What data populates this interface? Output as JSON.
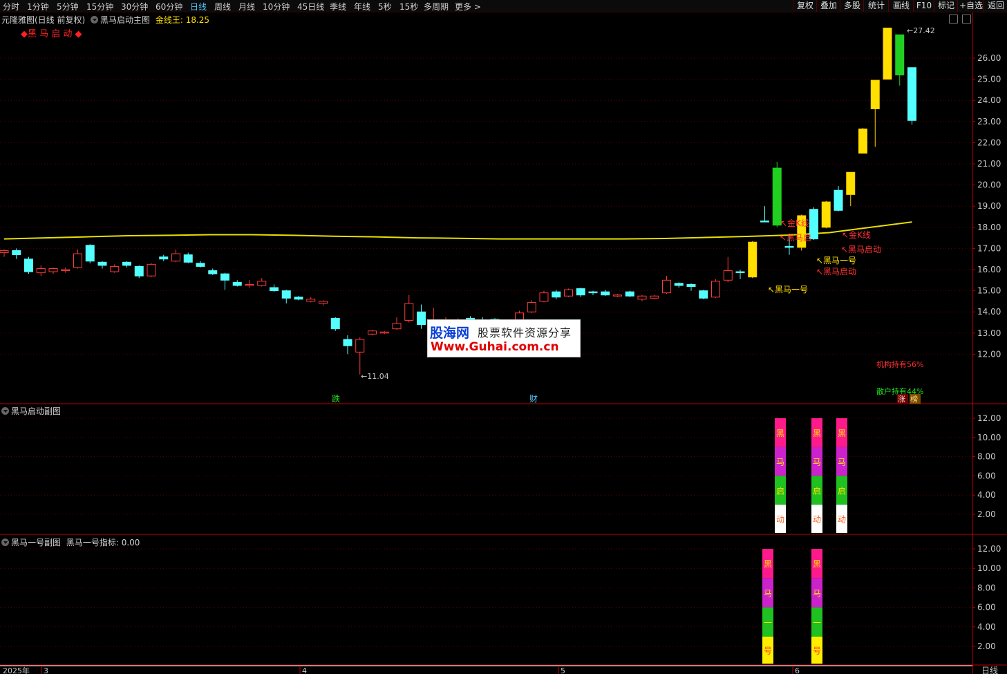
{
  "toolbar": {
    "periods": [
      "分时",
      "1分钟",
      "5分钟",
      "15分钟",
      "30分钟",
      "60分钟",
      "日线",
      "周线",
      "月线",
      "10分钟",
      "45日线",
      "季线",
      "年线",
      "5秒",
      "15秒",
      "多周期",
      "更多 >"
    ],
    "active_period": "日线",
    "right_buttons": [
      "复权",
      "叠加",
      "多股",
      "统计",
      "画线",
      "F10",
      "标记",
      "+自选",
      "返回"
    ]
  },
  "main_panel": {
    "font_name": "元隆雅图(日线 前复权)",
    "indicator_name": "黑马启动主图",
    "line_label": "金线王: 18.25",
    "signal_title": "◆黑 马 启 动 ◆",
    "high_label": "27.42",
    "low_label": "←11.04",
    "signals": {
      "jin_k": "金K线",
      "heima_qi": "黑马启",
      "heima_qidong": "黑马启动",
      "heima_yihao": "黑马一号"
    },
    "institution": "机构持有56%",
    "retail": "散户持有44%",
    "markers": {
      "die": "跌",
      "cai": "财",
      "zhang": "涨",
      "bang": "榜"
    },
    "y_ticks": [
      "26.00",
      "25.00",
      "24.00",
      "23.00",
      "22.00",
      "21.00",
      "20.00",
      "19.00",
      "18.00",
      "17.00",
      "16.00",
      "15.00",
      "14.00",
      "13.00",
      "12.00"
    ]
  },
  "sub_panel1": {
    "title": "黑马启动副图",
    "y_ticks": [
      "12.00",
      "10.00",
      "8.00",
      "6.00",
      "4.00",
      "2.00"
    ],
    "chars": [
      "黑",
      "马",
      "启",
      "动"
    ]
  },
  "sub_panel2": {
    "title": "黑马一号副图",
    "indicator_label": "黑马一号指标: 0.00",
    "y_ticks": [
      "12.00",
      "10.00",
      "8.00",
      "6.00",
      "4.00",
      "2.00"
    ],
    "chars": [
      "黑",
      "马",
      "一",
      "号"
    ]
  },
  "x_axis": {
    "labels": [
      "2025年",
      "3",
      "4",
      "5",
      "6"
    ],
    "corner": "日线"
  },
  "watermark": {
    "logo": "股海网",
    "subtitle": "股票软件资源分享",
    "url": "Www.Guhai.com.cn"
  },
  "colors": {
    "up": "#ff3b3b",
    "down": "#54ffff",
    "gold": "#ffe000",
    "green_bull": "#20d020",
    "line": "#e8e000",
    "grid": "#5a0000",
    "axis": "#c00000"
  },
  "chart_data": {
    "type": "candlestick",
    "title": "",
    "ylim": [
      10.7,
      27.8
    ],
    "candles": [
      {
        "o": 16.8,
        "h": 16.95,
        "l": 16.6,
        "c": 16.9,
        "s": "u"
      },
      {
        "o": 16.9,
        "h": 17.0,
        "l": 16.5,
        "c": 16.7,
        "s": "d"
      },
      {
        "o": 16.5,
        "h": 16.6,
        "l": 15.8,
        "c": 15.9,
        "s": "d"
      },
      {
        "o": 15.85,
        "h": 16.2,
        "l": 15.7,
        "c": 16.05,
        "s": "u"
      },
      {
        "o": 15.9,
        "h": 16.1,
        "l": 15.8,
        "c": 16.05,
        "s": "u"
      },
      {
        "o": 15.95,
        "h": 16.1,
        "l": 15.85,
        "c": 16.0,
        "s": "u"
      },
      {
        "o": 16.1,
        "h": 16.95,
        "l": 16.05,
        "c": 16.75,
        "s": "u"
      },
      {
        "o": 17.15,
        "h": 17.2,
        "l": 16.3,
        "c": 16.4,
        "s": "d"
      },
      {
        "o": 16.35,
        "h": 16.4,
        "l": 16.05,
        "c": 16.2,
        "s": "d"
      },
      {
        "o": 15.9,
        "h": 16.25,
        "l": 15.85,
        "c": 16.15,
        "s": "u"
      },
      {
        "o": 16.35,
        "h": 16.4,
        "l": 16.1,
        "c": 16.2,
        "s": "d"
      },
      {
        "o": 16.15,
        "h": 16.2,
        "l": 15.6,
        "c": 15.7,
        "s": "d"
      },
      {
        "o": 15.7,
        "h": 16.3,
        "l": 15.65,
        "c": 16.25,
        "s": "u"
      },
      {
        "o": 16.5,
        "h": 16.7,
        "l": 16.4,
        "c": 16.6,
        "s": "d"
      },
      {
        "o": 16.4,
        "h": 16.95,
        "l": 16.35,
        "c": 16.75,
        "s": "u"
      },
      {
        "o": 16.7,
        "h": 16.8,
        "l": 16.3,
        "c": 16.35,
        "s": "d"
      },
      {
        "o": 16.3,
        "h": 16.4,
        "l": 16.1,
        "c": 16.15,
        "s": "d"
      },
      {
        "o": 15.95,
        "h": 16.05,
        "l": 15.75,
        "c": 15.8,
        "s": "d"
      },
      {
        "o": 15.8,
        "h": 15.85,
        "l": 15.05,
        "c": 15.5,
        "s": "d"
      },
      {
        "o": 15.4,
        "h": 15.5,
        "l": 15.2,
        "c": 15.25,
        "s": "d"
      },
      {
        "o": 15.25,
        "h": 15.5,
        "l": 15.15,
        "c": 15.3,
        "s": "u"
      },
      {
        "o": 15.25,
        "h": 15.6,
        "l": 15.2,
        "c": 15.45,
        "s": "u"
      },
      {
        "o": 15.15,
        "h": 15.3,
        "l": 14.95,
        "c": 15.0,
        "s": "d"
      },
      {
        "o": 15.0,
        "h": 15.05,
        "l": 14.4,
        "c": 14.65,
        "s": "d"
      },
      {
        "o": 14.7,
        "h": 14.75,
        "l": 14.55,
        "c": 14.6,
        "s": "d"
      },
      {
        "o": 14.5,
        "h": 14.7,
        "l": 14.45,
        "c": 14.6,
        "s": "u"
      },
      {
        "o": 14.4,
        "h": 14.55,
        "l": 14.3,
        "c": 14.5,
        "s": "u"
      },
      {
        "o": 13.7,
        "h": 13.75,
        "l": 13.1,
        "c": 13.2,
        "s": "d"
      },
      {
        "o": 12.7,
        "h": 12.9,
        "l": 12.0,
        "c": 12.4,
        "s": "d"
      },
      {
        "o": 12.1,
        "h": 12.8,
        "l": 11.04,
        "c": 12.7,
        "s": "u"
      },
      {
        "o": 12.95,
        "h": 13.15,
        "l": 12.9,
        "c": 13.1,
        "s": "u"
      },
      {
        "o": 13.0,
        "h": 13.1,
        "l": 12.95,
        "c": 13.05,
        "s": "u"
      },
      {
        "o": 13.2,
        "h": 13.75,
        "l": 13.15,
        "c": 13.45,
        "s": "u"
      },
      {
        "o": 13.6,
        "h": 14.8,
        "l": 13.5,
        "c": 14.4,
        "s": "u"
      },
      {
        "o": 14.0,
        "h": 14.35,
        "l": 13.2,
        "c": 13.4,
        "s": "d"
      },
      {
        "o": 13.2,
        "h": 14.2,
        "l": 13.1,
        "c": 13.55,
        "s": "u"
      },
      {
        "o": 13.3,
        "h": 13.75,
        "l": 13.2,
        "c": 13.6,
        "s": "u"
      },
      {
        "o": 13.5,
        "h": 13.7,
        "l": 13.4,
        "c": 13.6,
        "s": "u"
      },
      {
        "o": 13.7,
        "h": 13.8,
        "l": 13.4,
        "c": 13.5,
        "s": "d"
      },
      {
        "o": 13.6,
        "h": 13.75,
        "l": 13.45,
        "c": 13.55,
        "s": "d"
      },
      {
        "o": 13.65,
        "h": 13.7,
        "l": 13.35,
        "c": 13.4,
        "s": "d"
      },
      {
        "o": 13.4,
        "h": 13.6,
        "l": 13.35,
        "c": 13.5,
        "s": "u"
      },
      {
        "o": 13.5,
        "h": 14.05,
        "l": 13.45,
        "c": 13.95,
        "s": "u"
      },
      {
        "o": 14.0,
        "h": 14.55,
        "l": 13.95,
        "c": 14.45,
        "s": "u"
      },
      {
        "o": 14.5,
        "h": 15.0,
        "l": 14.45,
        "c": 14.9,
        "s": "u"
      },
      {
        "o": 14.95,
        "h": 15.05,
        "l": 14.6,
        "c": 14.7,
        "s": "d"
      },
      {
        "o": 14.75,
        "h": 15.1,
        "l": 14.7,
        "c": 15.05,
        "s": "u"
      },
      {
        "o": 15.1,
        "h": 15.15,
        "l": 14.7,
        "c": 14.8,
        "s": "d"
      },
      {
        "o": 14.9,
        "h": 15.0,
        "l": 14.8,
        "c": 14.95,
        "s": "d"
      },
      {
        "o": 14.95,
        "h": 15.05,
        "l": 14.75,
        "c": 14.8,
        "s": "d"
      },
      {
        "o": 14.75,
        "h": 14.85,
        "l": 14.7,
        "c": 14.8,
        "s": "u"
      },
      {
        "o": 14.95,
        "h": 15.0,
        "l": 14.7,
        "c": 14.75,
        "s": "d"
      },
      {
        "o": 14.6,
        "h": 14.8,
        "l": 14.5,
        "c": 14.75,
        "s": "u"
      },
      {
        "o": 14.65,
        "h": 14.8,
        "l": 14.6,
        "c": 14.75,
        "s": "u"
      },
      {
        "o": 14.9,
        "h": 15.7,
        "l": 14.85,
        "c": 15.5,
        "s": "u"
      },
      {
        "o": 15.35,
        "h": 15.4,
        "l": 15.15,
        "c": 15.25,
        "s": "d"
      },
      {
        "o": 15.3,
        "h": 15.35,
        "l": 15.0,
        "c": 15.2,
        "s": "d"
      },
      {
        "o": 15.0,
        "h": 15.05,
        "l": 14.6,
        "c": 14.65,
        "s": "d"
      },
      {
        "o": 14.7,
        "h": 15.55,
        "l": 14.65,
        "c": 15.45,
        "s": "u"
      },
      {
        "o": 15.5,
        "h": 16.6,
        "l": 15.4,
        "c": 15.95,
        "s": "u"
      },
      {
        "o": 15.9,
        "h": 16.0,
        "l": 15.55,
        "c": 15.9,
        "s": "d"
      },
      {
        "o": 15.65,
        "h": 17.35,
        "l": 15.6,
        "c": 17.3,
        "s": "g"
      },
      {
        "o": 18.3,
        "h": 19.0,
        "l": 18.3,
        "c": 18.3,
        "s": "d"
      },
      {
        "o": 18.1,
        "h": 21.1,
        "l": 18.0,
        "c": 20.8,
        "s": "v"
      },
      {
        "o": 17.05,
        "h": 17.6,
        "l": 16.7,
        "c": 17.1,
        "s": "d"
      },
      {
        "o": 17.05,
        "h": 18.6,
        "l": 16.9,
        "c": 18.55,
        "s": "g"
      },
      {
        "o": 18.85,
        "h": 18.95,
        "l": 17.4,
        "c": 17.45,
        "s": "d"
      },
      {
        "o": 18.0,
        "h": 19.25,
        "l": 17.95,
        "c": 19.2,
        "s": "g"
      },
      {
        "o": 19.75,
        "h": 19.95,
        "l": 18.75,
        "c": 18.8,
        "s": "d"
      },
      {
        "o": 19.55,
        "h": 20.6,
        "l": 19.0,
        "c": 20.6,
        "s": "g"
      },
      {
        "o": 21.5,
        "h": 22.7,
        "l": 21.5,
        "c": 22.65,
        "s": "g"
      },
      {
        "o": 23.6,
        "h": 24.95,
        "l": 21.8,
        "c": 24.95,
        "s": "g"
      },
      {
        "o": 25.0,
        "h": 27.42,
        "l": 25.0,
        "c": 27.42,
        "s": "g"
      },
      {
        "o": 27.1,
        "h": 27.1,
        "l": 24.7,
        "c": 25.2,
        "s": "v"
      },
      {
        "o": 25.55,
        "h": 25.55,
        "l": 22.85,
        "c": 23.05,
        "s": "d"
      }
    ],
    "line_values": [
      17.45,
      17.5,
      17.55,
      17.6,
      17.62,
      17.65,
      17.65,
      17.62,
      17.58,
      17.55,
      17.5,
      17.48,
      17.45,
      17.45,
      17.45,
      17.45,
      17.47,
      17.52,
      17.57,
      17.63,
      17.75,
      18.0,
      18.25
    ]
  }
}
